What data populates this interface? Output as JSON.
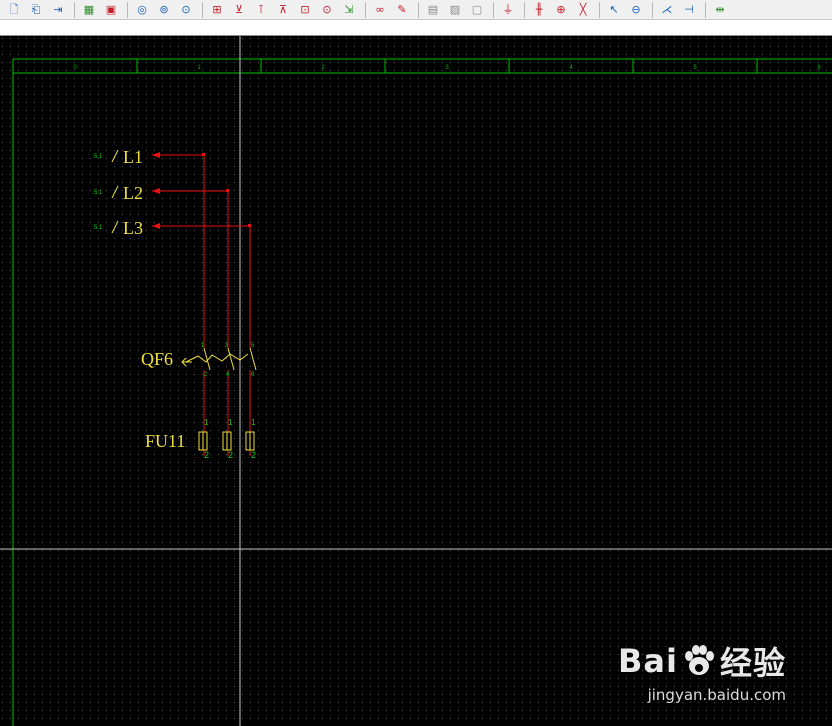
{
  "toolbar": {
    "icons": [
      "new-sheet-icon",
      "open-icon",
      "export-icon",
      "layout-icon",
      "component-icon",
      "symbol-icon",
      "symbol-rotate-icon",
      "symbol-align-icon",
      "terminal-icon",
      "insert-device-icon",
      "connect-device-icon",
      "bus-icon",
      "device-box-icon",
      "device-alt-icon",
      "arrow-link-icon",
      "cable-icon",
      "pen-icon",
      "fill-icon",
      "hatch-icon",
      "frame-icon",
      "ground-icon",
      "wire-break-icon",
      "wire-cross-icon",
      "wire-diagonal-icon",
      "pointer-icon",
      "measure-icon",
      "trim-icon",
      "extend-icon",
      "mirror-icon"
    ]
  },
  "sheet": {
    "column_labels": [
      "0",
      "1",
      "2",
      "3",
      "4",
      "5",
      "6"
    ],
    "line_color": "#00c000",
    "grid_color": "#5a5a5a",
    "cursor_color": "#c8c8c8"
  },
  "schematic": {
    "potentials": [
      {
        "ref": "5.1",
        "name": "L1"
      },
      {
        "ref": "5.1",
        "name": "L2"
      },
      {
        "ref": "5.1",
        "name": "L3"
      }
    ],
    "breaker": {
      "name": "QF6",
      "pins_top": [
        "1",
        "3",
        "5"
      ],
      "pins_bottom": [
        "2",
        "4",
        "6"
      ]
    },
    "fuse": {
      "name": "FU11",
      "pins_top": [
        "1",
        "1",
        "1"
      ],
      "pins_bottom": [
        "2",
        "2",
        "2"
      ]
    },
    "wire_color": "#e81010",
    "label_color": "#f0e040",
    "pin_color": "#10d010"
  },
  "watermark": {
    "brand": "Bai",
    "brand2": "经验",
    "url": "jingyan.baidu.com"
  }
}
